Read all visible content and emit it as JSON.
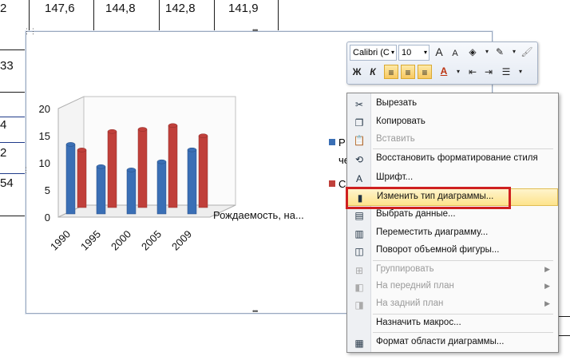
{
  "sheet": {
    "top_row": [
      "2",
      "147,6",
      "144,8",
      "142,8",
      "141,9"
    ],
    "left_fragments": [
      "33",
      "4",
      "2",
      "54"
    ]
  },
  "chart": {
    "legend_fragments": [
      "Р",
      "че",
      "С"
    ],
    "series_label": "Рождаемость, на...",
    "colors": {
      "series1": "#3a6fb5",
      "series2": "#c0403b"
    }
  },
  "chart_data": {
    "type": "bar",
    "categories": [
      "1990",
      "1995",
      "2000",
      "2005",
      "2009"
    ],
    "series": [
      {
        "values": [
          13.4,
          9.3,
          8.7,
          10.2,
          12.4
        ]
      },
      {
        "values": [
          11.2,
          14.6,
          15.0,
          15.7,
          13.8
        ]
      }
    ],
    "ylim": [
      0,
      20
    ],
    "yticks": [
      "0",
      "5",
      "10",
      "15",
      "20"
    ],
    "grid": false
  },
  "toolbar": {
    "font_name": "Calibri (С",
    "font_size": "10",
    "grow_font": "A",
    "shrink_font": "A",
    "bold": "Ж",
    "italic": "К",
    "font_color": "A"
  },
  "menu": {
    "items": [
      {
        "label": "Вырезать",
        "icon": "scissors-icon",
        "glyph": "✂",
        "disabled": false
      },
      {
        "label": "Копировать",
        "icon": "copy-icon",
        "glyph": "❐",
        "disabled": false
      },
      {
        "label": "Вставить",
        "icon": "paste-icon",
        "glyph": "📋",
        "disabled": true
      },
      {
        "label": "Восстановить форматирование стиля",
        "icon": "reset-style-icon",
        "glyph": "⟲",
        "disabled": false
      },
      {
        "label": "Шрифт...",
        "icon": "font-icon",
        "glyph": "A",
        "disabled": false
      },
      {
        "label": "Изменить тип диаграммы...",
        "icon": "chart-type-icon",
        "glyph": "▮",
        "disabled": false
      },
      {
        "label": "Выбрать данные...",
        "icon": "select-data-icon",
        "glyph": "▤",
        "disabled": false
      },
      {
        "label": "Переместить диаграмму...",
        "icon": "move-chart-icon",
        "glyph": "▥",
        "disabled": false
      },
      {
        "label": "Поворот объемной фигуры...",
        "icon": "rotate-3d-icon",
        "glyph": "◫",
        "disabled": false
      },
      {
        "label": "Группировать",
        "icon": "group-icon",
        "glyph": "⊞",
        "disabled": true
      },
      {
        "label": "На передний план",
        "icon": "bring-front-icon",
        "glyph": "◧",
        "disabled": true
      },
      {
        "label": "На задний план",
        "icon": "send-back-icon",
        "glyph": "◨",
        "disabled": true
      },
      {
        "label": "Назначить макрос...",
        "icon": "macro-icon",
        "glyph": "",
        "disabled": false
      },
      {
        "label": "Формат области диаграммы...",
        "icon": "format-area-icon",
        "glyph": "▦",
        "disabled": false
      }
    ]
  }
}
